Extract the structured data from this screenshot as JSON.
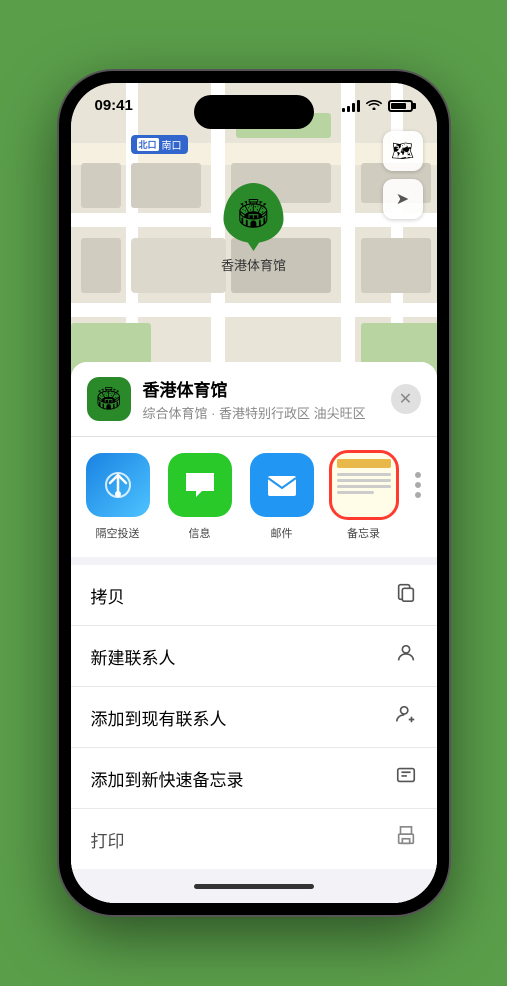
{
  "status_bar": {
    "time": "09:41",
    "signal_label": "signal",
    "wifi_label": "wifi",
    "battery_label": "battery"
  },
  "map": {
    "label": "南口",
    "marker_label": "香港体育馆",
    "control_map": "🗺",
    "control_location": "➤"
  },
  "location_card": {
    "name": "香港体育馆",
    "description": "综合体育馆 · 香港特别行政区 油尖旺区",
    "close": "✕"
  },
  "share_items": [
    {
      "id": "airdrop",
      "label": "隔空投送",
      "type": "airdrop"
    },
    {
      "id": "message",
      "label": "信息",
      "type": "message"
    },
    {
      "id": "mail",
      "label": "邮件",
      "type": "mail"
    },
    {
      "id": "notes",
      "label": "备忘录",
      "type": "notes",
      "selected": true
    }
  ],
  "actions": [
    {
      "id": "copy",
      "label": "拷贝",
      "icon": "📋"
    },
    {
      "id": "new-contact",
      "label": "新建联系人",
      "icon": "👤"
    },
    {
      "id": "add-contact",
      "label": "添加到现有联系人",
      "icon": "👤"
    },
    {
      "id": "quick-note",
      "label": "添加到新快速备忘录",
      "icon": "📝"
    },
    {
      "id": "print",
      "label": "打印",
      "icon": "🖨"
    }
  ]
}
